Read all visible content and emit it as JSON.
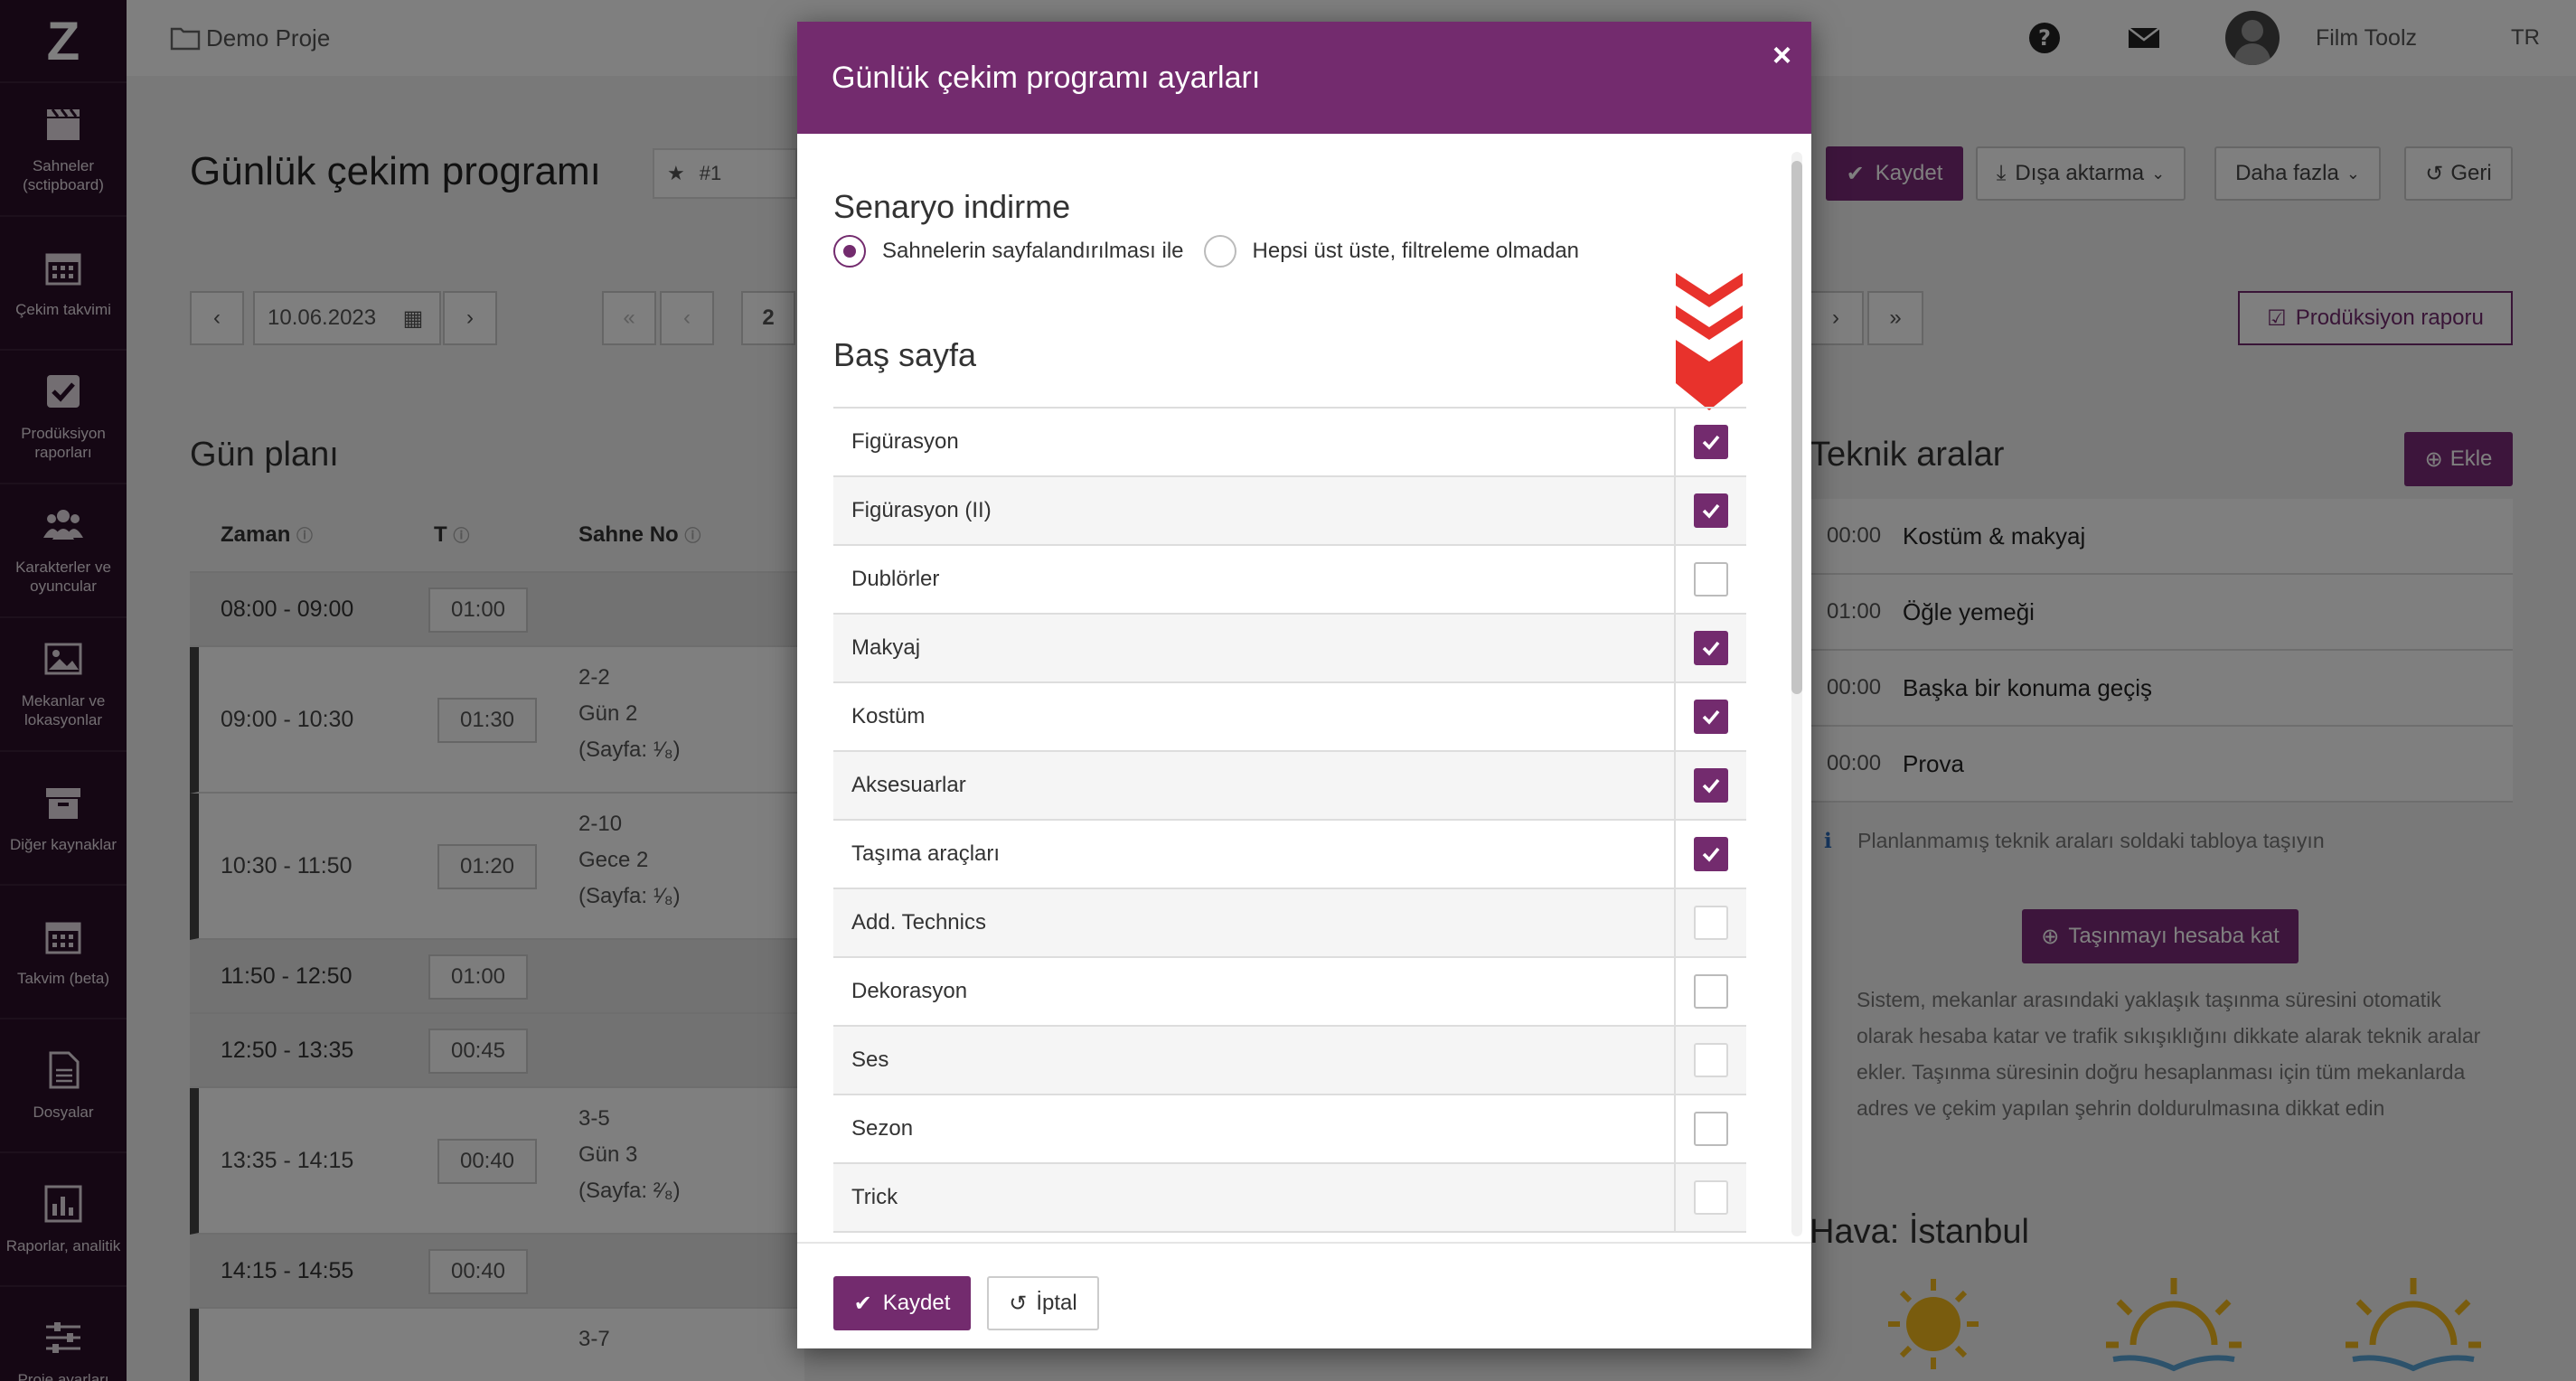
{
  "topbar": {
    "project": "Demo Proje",
    "user": "Film Toolz",
    "lang": "TR"
  },
  "sidebar": {
    "logo": "Z",
    "items": [
      {
        "label": "Sahneler (sctipboard)",
        "icon": "clapperboard-icon"
      },
      {
        "label": "Çekim takvimi",
        "icon": "calendar-icon"
      },
      {
        "label": "Prodüksiyon raporları",
        "icon": "checkbox-icon"
      },
      {
        "label": "Karakterler ve oyuncular",
        "icon": "users-icon"
      },
      {
        "label": "Mekanlar ve lokasyonlar",
        "icon": "image-icon"
      },
      {
        "label": "Diğer kaynaklar",
        "icon": "archive-icon"
      },
      {
        "label": "Takvim (beta)",
        "icon": "calendar-icon"
      },
      {
        "label": "Dosyalar",
        "icon": "file-icon"
      },
      {
        "label": "Raporlar, analitik",
        "icon": "bar-chart-icon"
      },
      {
        "label": "Proje ayarları",
        "icon": "sliders-icon"
      }
    ]
  },
  "page": {
    "title": "Günlük çekim programı",
    "fav": "#1",
    "toolbar": {
      "save": "Kaydet",
      "export": "Dışa aktarma",
      "more": "Daha fazla",
      "back": "Geri"
    },
    "date": "10.06.2023",
    "page_num": "2",
    "prod_report": "Prodüksiyon raporu"
  },
  "plan": {
    "title": "Gün planı",
    "headers": {
      "time": "Zaman",
      "t": "T",
      "scene": "Sahne No"
    },
    "rows": [
      {
        "time": "08:00 - 09:00",
        "dur": "01:00",
        "l1": "",
        "l2": "",
        "l3": "",
        "type": "gray"
      },
      {
        "time": "09:00 - 10:30",
        "dur": "01:30",
        "l1": "2-2",
        "l2": "Gün 2",
        "l3": "(Sayfa: ¹⁄₈)",
        "type": "block"
      },
      {
        "time": "10:30 - 11:50",
        "dur": "01:20",
        "l1": "2-10",
        "l2": "Gece 2",
        "l3": "(Sayfa: ¹⁄₈)",
        "type": "block"
      },
      {
        "time": "11:50 - 12:50",
        "dur": "01:00",
        "l1": "",
        "l2": "",
        "l3": "",
        "type": "gray"
      },
      {
        "time": "12:50 - 13:35",
        "dur": "00:45",
        "l1": "",
        "l2": "",
        "l3": "",
        "type": "gray"
      },
      {
        "time": "13:35 - 14:15",
        "dur": "00:40",
        "l1": "3-5",
        "l2": "Gün 3",
        "l3": "(Sayfa: ²⁄₈)",
        "type": "block"
      },
      {
        "time": "14:15 - 14:55",
        "dur": "00:40",
        "l1": "",
        "l2": "",
        "l3": "",
        "type": "gray"
      },
      {
        "time": "",
        "dur": "",
        "l1": "3-7",
        "l2": "",
        "l3": "",
        "type": "block"
      }
    ]
  },
  "tech": {
    "title": "Teknik aralar",
    "add": "Ekle",
    "items": [
      {
        "time": "00:00",
        "name": "Kostüm & makyaj"
      },
      {
        "time": "01:00",
        "name": "Öğle yemeği"
      },
      {
        "time": "00:00",
        "name": "Başka bir konuma geçiş"
      },
      {
        "time": "00:00",
        "name": "Prova"
      }
    ],
    "hint": "Planlanmamış teknik araları soldaki tabloya taşıyın",
    "calc_button": "Taşınmayı hesaba kat",
    "note": [
      "Sistem, mekanlar arasındaki yaklaşık taşınma süresini otomatik",
      "olarak hesaba katar ve trafik sıkışıklığını dikkate alarak teknik aralar",
      "ekler. Taşınma süresinin doğru hesaplanması için tüm mekanlarda",
      "adres ve çekim yapılan şehrin doldurulmasına dikkat edin"
    ],
    "weather": "Hava: İstanbul"
  },
  "modal": {
    "title": "Günlük çekim programı ayarları",
    "section1": "Senaryo indirme",
    "radio1": "Sahnelerin sayfalandırılması ile",
    "radio2": "Hepsi üst üste, filtreleme olmadan",
    "section2": "Baş sayfa",
    "items": [
      {
        "label": "Figürasyon",
        "state": "checked"
      },
      {
        "label": "Figürasyon (II)",
        "state": "checked"
      },
      {
        "label": "Dublörler",
        "state": "unchecked"
      },
      {
        "label": "Makyaj",
        "state": "checked"
      },
      {
        "label": "Kostüm",
        "state": "checked"
      },
      {
        "label": "Aksesuarlar",
        "state": "checked"
      },
      {
        "label": "Taşıma araçları",
        "state": "checked"
      },
      {
        "label": "Add. Technics",
        "state": "dim"
      },
      {
        "label": "Dekorasyon",
        "state": "unchecked"
      },
      {
        "label": "Ses",
        "state": "dim"
      },
      {
        "label": "Sezon",
        "state": "unchecked"
      },
      {
        "label": "Trick",
        "state": "dim"
      }
    ],
    "save": "Kaydet",
    "cancel": "İptal",
    "close": "×"
  },
  "colors": {
    "brand": "#732b6e",
    "sidebar": "#2a0f28",
    "marker": "#e8322c"
  }
}
